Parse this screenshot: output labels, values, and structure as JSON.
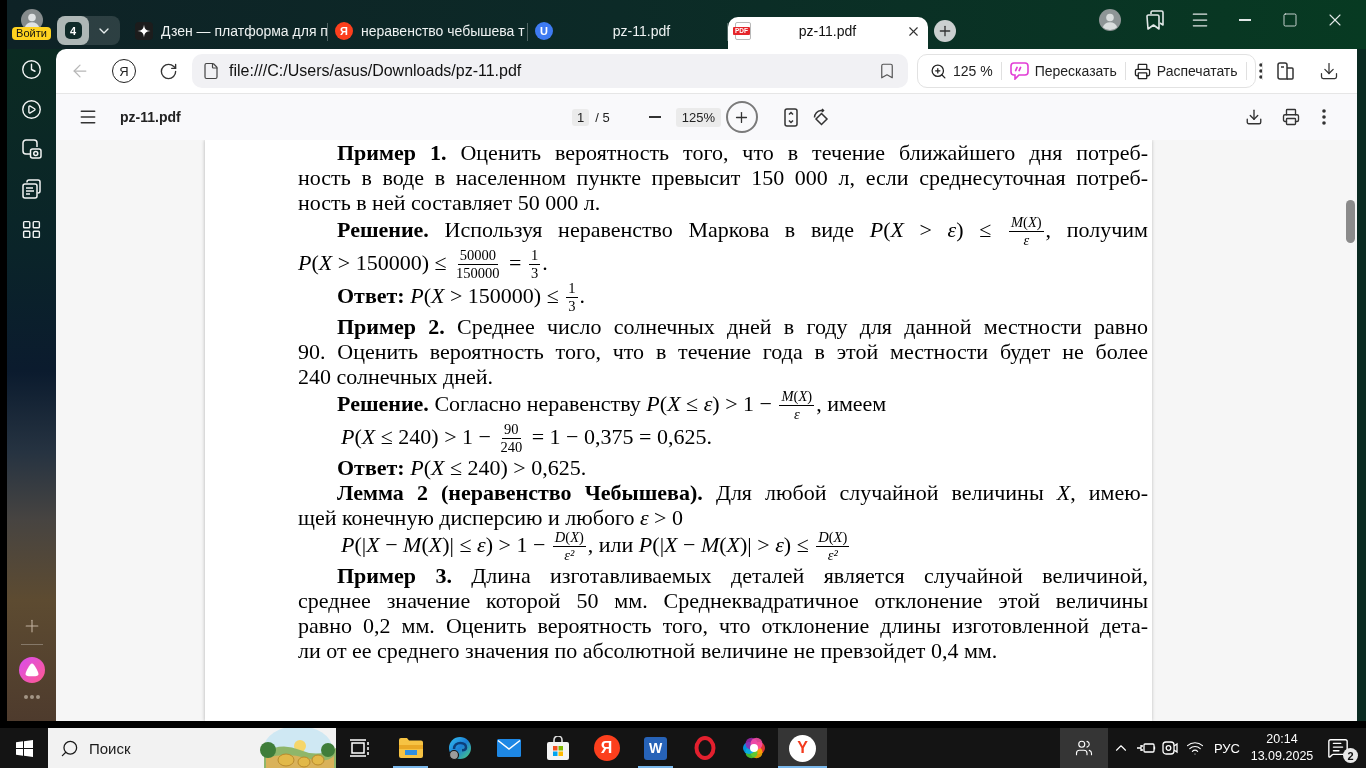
{
  "browser": {
    "profile": {
      "label": "Войти"
    },
    "tab_group": {
      "count": "4"
    },
    "tabs": [
      {
        "title": "Дзен — платформа для п",
        "selected": false
      },
      {
        "title": "неравенство чебышева т",
        "selected": false,
        "favicon": {
          "kind": "circle",
          "text": "Я",
          "color": "#fc3f1d"
        }
      },
      {
        "title": "pz-11.pdf",
        "selected": false,
        "favicon": {
          "kind": "circle",
          "text": "U",
          "color": "#3e7bf2"
        }
      },
      {
        "title": "pz-11.pdf",
        "selected": true,
        "favicon": {
          "kind": "document",
          "text": "PDF",
          "color": "#e5252a"
        }
      }
    ],
    "navigation": {
      "back_disabled": true,
      "logo": "Я"
    },
    "address_bar": {
      "url": "file:///C:/Users/asus/Downloads/pz-11.pdf"
    },
    "page_actions": {
      "zoom": "125 %",
      "retell": "Пересказать",
      "print": "Распечатать"
    }
  },
  "pdf_viewer": {
    "title": "pz-11.pdf",
    "page": "1",
    "page_count": "/ 5",
    "zoom": "125%",
    "paragraphs": [
      {
        "kind": "paragraph",
        "lines": [
          [
            {
              "kind": "text",
              "text": "**Пример 1.** Оценить вероятность того, что в течение ближайшего дня потреб-"
            }
          ],
          [
            {
              "kind": "text",
              "text": "ность в воде в населенном пункте превысит 150 000 л, если среднесуточная потреб-"
            }
          ],
          [
            {
              "kind": "text",
              "text": "ность в ней составляет 50 000 л."
            }
          ]
        ]
      },
      {
        "kind": "paragraph",
        "lines": [
          [
            {
              "kind": "text",
              "text": "**Решение.** Используя неравенство Маркова в виде *P*(*X* > *ε*) ≤ "
            },
            {
              "kind": "fraction",
              "num": "*M*(*X*)",
              "den": "*ε*"
            },
            {
              "kind": "text",
              "text": ", получим"
            }
          ],
          [
            {
              "kind": "text",
              "text": "*P*(*X* > 150000) ≤ "
            },
            {
              "kind": "fraction",
              "num": "50000",
              "den": "150000"
            },
            {
              "kind": "text",
              "text": " = "
            },
            {
              "kind": "fraction",
              "num": "1",
              "den": "3"
            },
            {
              "kind": "text",
              "text": "."
            }
          ]
        ]
      },
      {
        "kind": "paragraph",
        "lines": [
          [
            {
              "kind": "text",
              "text": "**Ответ:** *P*(*X* > 150000) ≤ "
            },
            {
              "kind": "fraction",
              "num": "1",
              "den": "3"
            },
            {
              "kind": "text",
              "text": "."
            }
          ]
        ]
      },
      {
        "kind": "paragraph",
        "lines": [
          [
            {
              "kind": "text",
              "text": "**Пример 2.** Среднее число солнечных дней в году для данной местности равно"
            }
          ],
          [
            {
              "kind": "text",
              "text": "90. Оценить вероятность того, что в течение года в этой местности будет не более"
            }
          ],
          [
            {
              "kind": "text",
              "text": "240 солнечных дней."
            }
          ]
        ]
      },
      {
        "kind": "paragraph",
        "lines": [
          [
            {
              "kind": "text",
              "text": "**Решение.** Согласно неравенству *P*(*X* ≤ *ε*) > 1 − "
            },
            {
              "kind": "fraction",
              "num": "*M*(*X*)",
              "den": "*ε*"
            },
            {
              "kind": "text",
              "text": ", имеем"
            }
          ]
        ]
      },
      {
        "kind": "formula",
        "lines": [
          [
            {
              "kind": "text",
              "text": "*P*(*X* ≤ 240) > 1 − "
            },
            {
              "kind": "fraction",
              "num": "90",
              "den": "240"
            },
            {
              "kind": "text",
              "text": " = 1 − 0,375 = 0,625."
            }
          ]
        ]
      },
      {
        "kind": "paragraph",
        "lines": [
          [
            {
              "kind": "text",
              "text": "**Ответ:** *P*(*X* ≤ 240) > 0,625."
            }
          ]
        ]
      },
      {
        "kind": "paragraph",
        "lines": [
          [
            {
              "kind": "text",
              "text": "**Лемма 2 (неравенство Чебышева).** Для любой случайной величины *X*, имею-"
            }
          ],
          [
            {
              "kind": "text",
              "text": "щей конечную дисперсию и любого *ε* > 0"
            }
          ]
        ]
      },
      {
        "kind": "formula",
        "lines": [
          [
            {
              "kind": "text",
              "text": "*P*(|*X* − *M*(*X*)| ≤ *ε*) > 1 − "
            },
            {
              "kind": "fraction",
              "num": "*D*(*X*)",
              "den": "*ε²*"
            },
            {
              "kind": "text",
              "text": ", или *P*(|*X* − *M*(*X*)| > *ε*) ≤ "
            },
            {
              "kind": "fraction",
              "num": "*D*(*X*)",
              "den": "*ε²*"
            }
          ]
        ]
      },
      {
        "kind": "paragraph",
        "lines": [
          [
            {
              "kind": "text",
              "text": "**Пример 3.** Длина изготавливаемых деталей является случайной величиной,"
            }
          ],
          [
            {
              "kind": "text",
              "text": "среднее значение которой 50 мм. Среднеквадратичное отклонение этой величины"
            }
          ],
          [
            {
              "kind": "text",
              "text": "равно 0,2 мм. Оценить вероятность того, что отклонение длины изготовленной дета-"
            }
          ],
          [
            {
              "kind": "text",
              "text": "ли от ее среднего значения по абсолютной величине не превзойдет 0,4 мм."
            }
          ]
        ]
      }
    ]
  },
  "taskbar": {
    "search": {
      "placeholder": "Поиск"
    },
    "apps": [
      {
        "running": true,
        "selected": false
      },
      {
        "running": false,
        "selected": false
      },
      {
        "running": false,
        "selected": false
      },
      {
        "running": false,
        "selected": false
      },
      {
        "running": false,
        "selected": false,
        "icon_text": "Я"
      },
      {
        "running": true,
        "selected": false,
        "icon_text": "W"
      },
      {
        "running": false,
        "selected": false
      },
      {
        "running": false,
        "selected": false
      },
      {
        "running": true,
        "selected": true,
        "icon_text": "Y"
      }
    ],
    "language": "РУС",
    "time": "20:14",
    "date": "13.09.2025",
    "notifications": "2"
  }
}
